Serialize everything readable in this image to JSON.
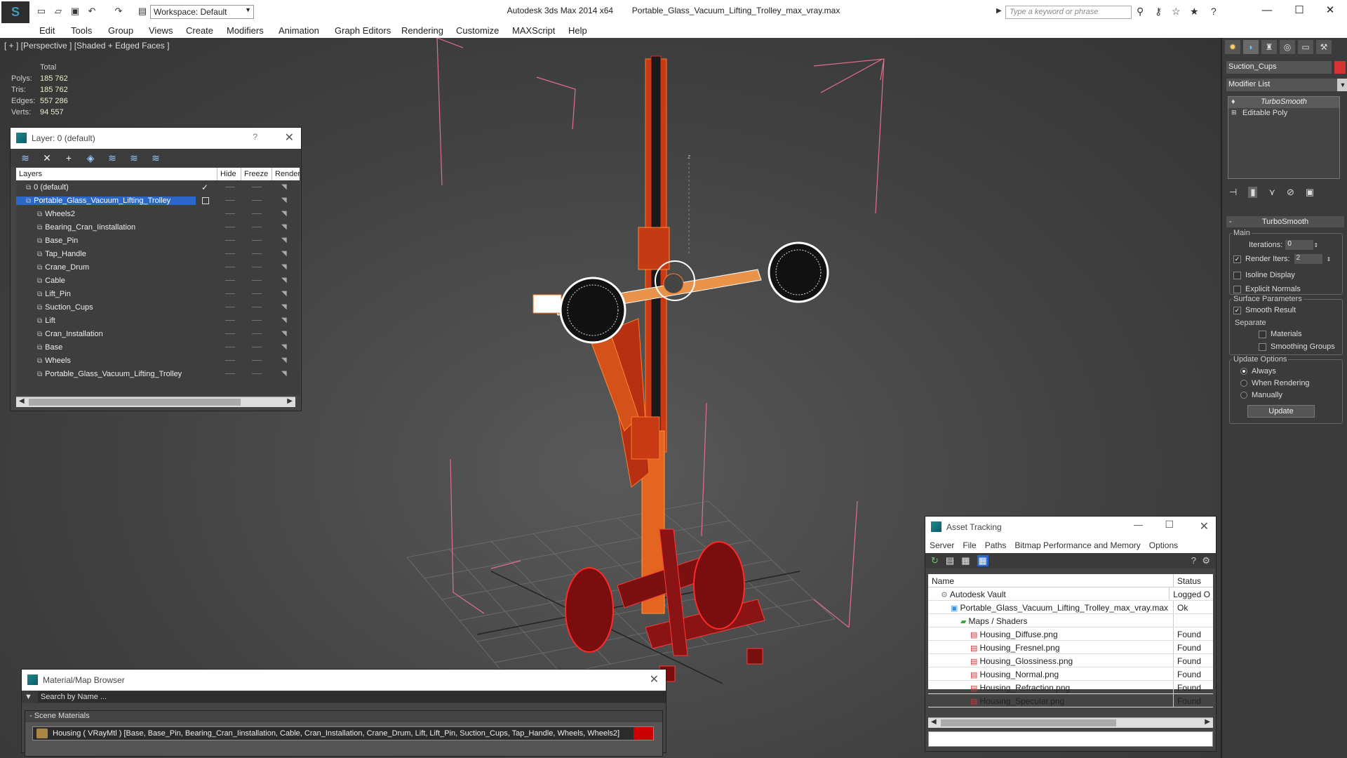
{
  "titlebar": {
    "workspace": "Workspace: Default",
    "app_name": "Autodesk 3ds Max  2014 x64",
    "file_name": "Portable_Glass_Vacuum_Lifting_Trolley_max_vray.max",
    "search_placeholder": "Type a keyword or phrase"
  },
  "menu": [
    "Edit",
    "Tools",
    "Group",
    "Views",
    "Create",
    "Modifiers",
    "Animation",
    "Graph Editors",
    "Rendering",
    "Customize",
    "MAXScript",
    "Help"
  ],
  "viewport": {
    "label": "[ + ] [Perspective ] [Shaded + Edged Faces ]",
    "stats": {
      "header": "Total",
      "rows": [
        {
          "k": "Polys:",
          "v": "185 762"
        },
        {
          "k": "Tris:",
          "v": "185 762"
        },
        {
          "k": "Edges:",
          "v": "557 286"
        },
        {
          "k": "Verts:",
          "v": "94 557"
        }
      ]
    },
    "axis_label": "z"
  },
  "layer_dialog": {
    "title": "Layer: 0 (default)",
    "help": "?",
    "columns": [
      "Layers",
      "Hide",
      "Freeze",
      "Render"
    ],
    "rows": [
      {
        "name": "0 (default)",
        "level": 1,
        "active": true
      },
      {
        "name": "Portable_Glass_Vacuum_Lifting_Trolley",
        "level": 1,
        "selected": true
      },
      {
        "name": "Wheels2",
        "level": 2
      },
      {
        "name": "Bearing_Cran_Iinstallation",
        "level": 2
      },
      {
        "name": "Base_Pin",
        "level": 2
      },
      {
        "name": "Tap_Handle",
        "level": 2
      },
      {
        "name": "Crane_Drum",
        "level": 2
      },
      {
        "name": "Cable",
        "level": 2
      },
      {
        "name": "Lift_Pin",
        "level": 2
      },
      {
        "name": "Suction_Cups",
        "level": 2
      },
      {
        "name": "Lift",
        "level": 2
      },
      {
        "name": "Cran_Installation",
        "level": 2
      },
      {
        "name": "Base",
        "level": 2
      },
      {
        "name": "Wheels",
        "level": 2
      },
      {
        "name": "Portable_Glass_Vacuum_Lifting_Trolley",
        "level": 2
      }
    ]
  },
  "material_browser": {
    "title": "Material/Map Browser",
    "search_placeholder": "Search by Name ...",
    "section": "- Scene Materials",
    "material": "Housing  ( VRayMtl )  [Base, Base_Pin, Bearing_Cran_Iinstallation, Cable, Cran_Installation, Crane_Drum, Lift, Lift_Pin, Suction_Cups, Tap_Handle, Wheels, Wheels2]"
  },
  "asset_tracking": {
    "title": "Asset Tracking",
    "menu": [
      "Server",
      "File",
      "Paths",
      "Bitmap Performance and Memory",
      "Options"
    ],
    "columns": [
      "Name",
      "Status"
    ],
    "rows": [
      {
        "name": "Autodesk Vault",
        "status": "Logged O",
        "indent": 1,
        "icon": "vault"
      },
      {
        "name": "Portable_Glass_Vacuum_Lifting_Trolley_max_vray.max",
        "status": "Ok",
        "indent": 2,
        "icon": "max"
      },
      {
        "name": "Maps / Shaders",
        "status": "",
        "indent": 3,
        "icon": "folder"
      },
      {
        "name": "Housing_Diffuse.png",
        "status": "Found",
        "indent": 4,
        "icon": "png"
      },
      {
        "name": "Housing_Fresnel.png",
        "status": "Found",
        "indent": 4,
        "icon": "png"
      },
      {
        "name": "Housing_Glossiness.png",
        "status": "Found",
        "indent": 4,
        "icon": "png"
      },
      {
        "name": "Housing_Normal.png",
        "status": "Found",
        "indent": 4,
        "icon": "png"
      },
      {
        "name": "Housing_Refraction.png",
        "status": "Found",
        "indent": 4,
        "icon": "png"
      },
      {
        "name": "Housing_Specular.png",
        "status": "Found",
        "indent": 4,
        "icon": "png"
      }
    ]
  },
  "command_panel": {
    "object_name": "Suction_Cups",
    "object_color": "#d33333",
    "modifier_list": "Modifier List",
    "stack": [
      "TurboSmooth",
      "Editable Poly"
    ],
    "rollout": "TurboSmooth",
    "main_group": "Main",
    "iterations_label": "Iterations:",
    "iterations_value": "0",
    "render_iters_label": "Render Iters:",
    "render_iters_value": "2",
    "isoline_display": "Isoline Display",
    "explicit_normals": "Explicit Normals",
    "surface_group": "Surface Parameters",
    "smooth_result": "Smooth Result",
    "separate_label": "Separate",
    "materials": "Materials",
    "smoothing_groups": "Smoothing Groups",
    "update_group": "Update Options",
    "always": "Always",
    "when_rendering": "When Rendering",
    "manually": "Manually",
    "update_button": "Update"
  }
}
